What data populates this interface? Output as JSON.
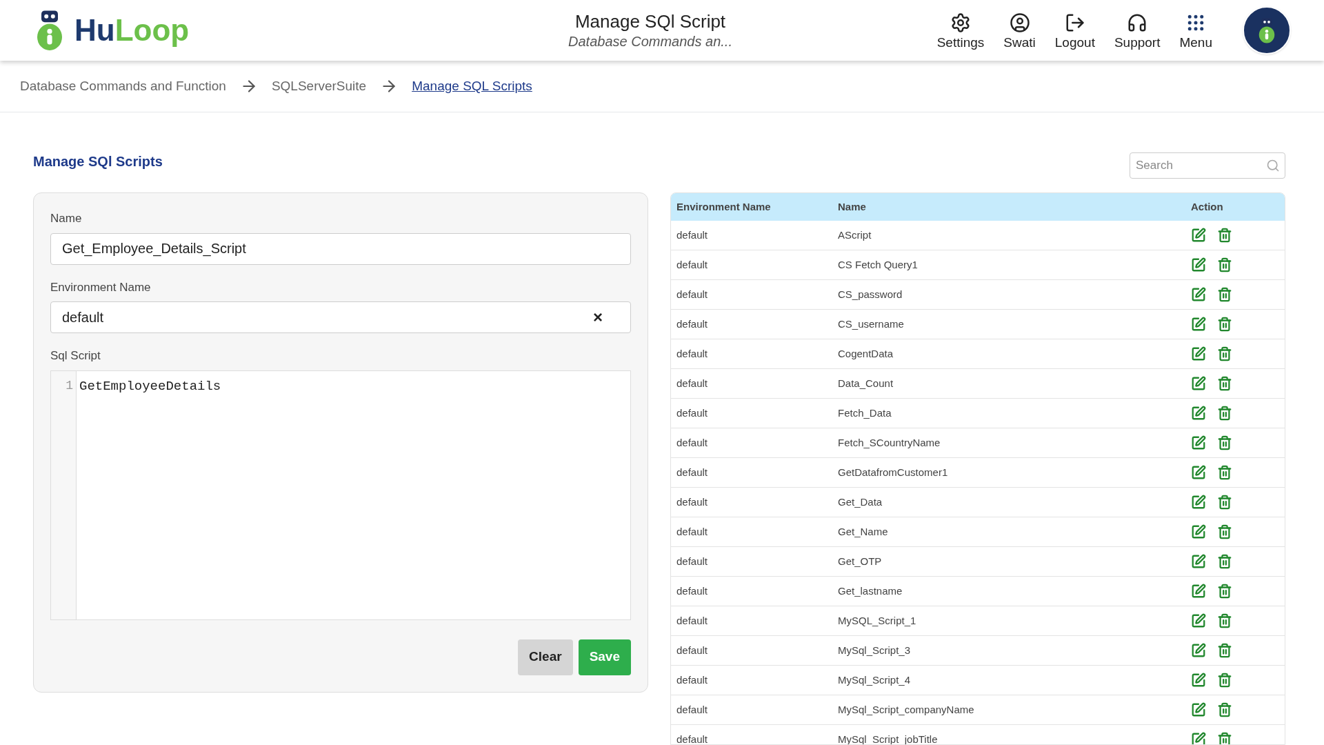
{
  "header": {
    "logo": {
      "text_a": "Hu",
      "text_b": "Loop"
    },
    "title": "Manage SQl Script",
    "subtitle": "Database Commands an...",
    "nav": [
      {
        "kind": "settings",
        "label": "Settings"
      },
      {
        "kind": "user",
        "label": "Swati"
      },
      {
        "kind": "logout",
        "label": "Logout"
      },
      {
        "kind": "support",
        "label": "Support"
      },
      {
        "kind": "menu",
        "label": "Menu"
      }
    ]
  },
  "breadcrumb": [
    {
      "label": "Database Commands and Function",
      "selected": false
    },
    {
      "label": "SQLServerSuite",
      "selected": false
    },
    {
      "label": "Manage SQL Scripts",
      "selected": true
    }
  ],
  "page_title": "Manage SQl Scripts",
  "search": {
    "placeholder": "Search"
  },
  "form": {
    "name_label": "Name",
    "name_value": "Get_Employee_Details_Script",
    "env_label": "Environment Name",
    "env_value": "default",
    "clear_icon": "×",
    "script_label": "Sql Script",
    "script_lines": [
      {
        "number": "1",
        "code": "GetEmployeeDetails"
      }
    ],
    "buttons": [
      {
        "kind": "secondary",
        "label": "Clear"
      },
      {
        "kind": "primary",
        "label": "Save"
      }
    ]
  },
  "table": {
    "columns": [
      "Environment Name",
      "Name",
      "Action"
    ],
    "rows": [
      {
        "env": "default",
        "name": "AScript"
      },
      {
        "env": "default",
        "name": "CS Fetch Query1"
      },
      {
        "env": "default",
        "name": "CS_password"
      },
      {
        "env": "default",
        "name": "CS_username"
      },
      {
        "env": "default",
        "name": "CogentData"
      },
      {
        "env": "default",
        "name": "Data_Count"
      },
      {
        "env": "default",
        "name": "Fetch_Data"
      },
      {
        "env": "default",
        "name": "Fetch_SCountryName"
      },
      {
        "env": "default",
        "name": "GetDatafromCustomer1"
      },
      {
        "env": "default",
        "name": "Get_Data"
      },
      {
        "env": "default",
        "name": "Get_Name"
      },
      {
        "env": "default",
        "name": "Get_OTP"
      },
      {
        "env": "default",
        "name": "Get_lastname"
      },
      {
        "env": "default",
        "name": "MySQL_Script_1"
      },
      {
        "env": "default",
        "name": "MySql_Script_3"
      },
      {
        "env": "default",
        "name": "MySql_Script_4"
      },
      {
        "env": "default",
        "name": "MySql_Script_companyName"
      },
      {
        "env": "default",
        "name": "MySql_Script_jobTitle"
      }
    ]
  }
}
